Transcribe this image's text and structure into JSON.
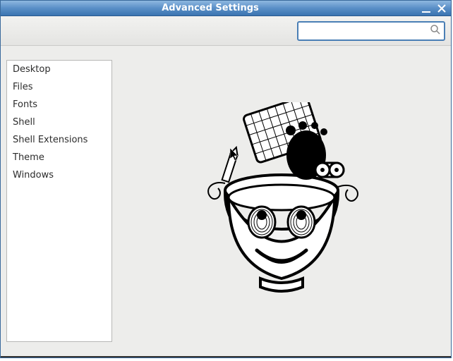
{
  "window": {
    "title": "Advanced Settings"
  },
  "toolbar": {
    "search_value": "",
    "search_placeholder": ""
  },
  "sidebar": {
    "items": [
      {
        "label": "Desktop"
      },
      {
        "label": "Files"
      },
      {
        "label": "Fonts"
      },
      {
        "label": "Shell"
      },
      {
        "label": "Shell Extensions"
      },
      {
        "label": "Theme"
      },
      {
        "label": "Windows"
      }
    ]
  },
  "icons": {
    "minimize": "minimize-icon",
    "close": "close-icon",
    "search": "search-icon",
    "mascot": "gnome-tweak-mascot"
  }
}
